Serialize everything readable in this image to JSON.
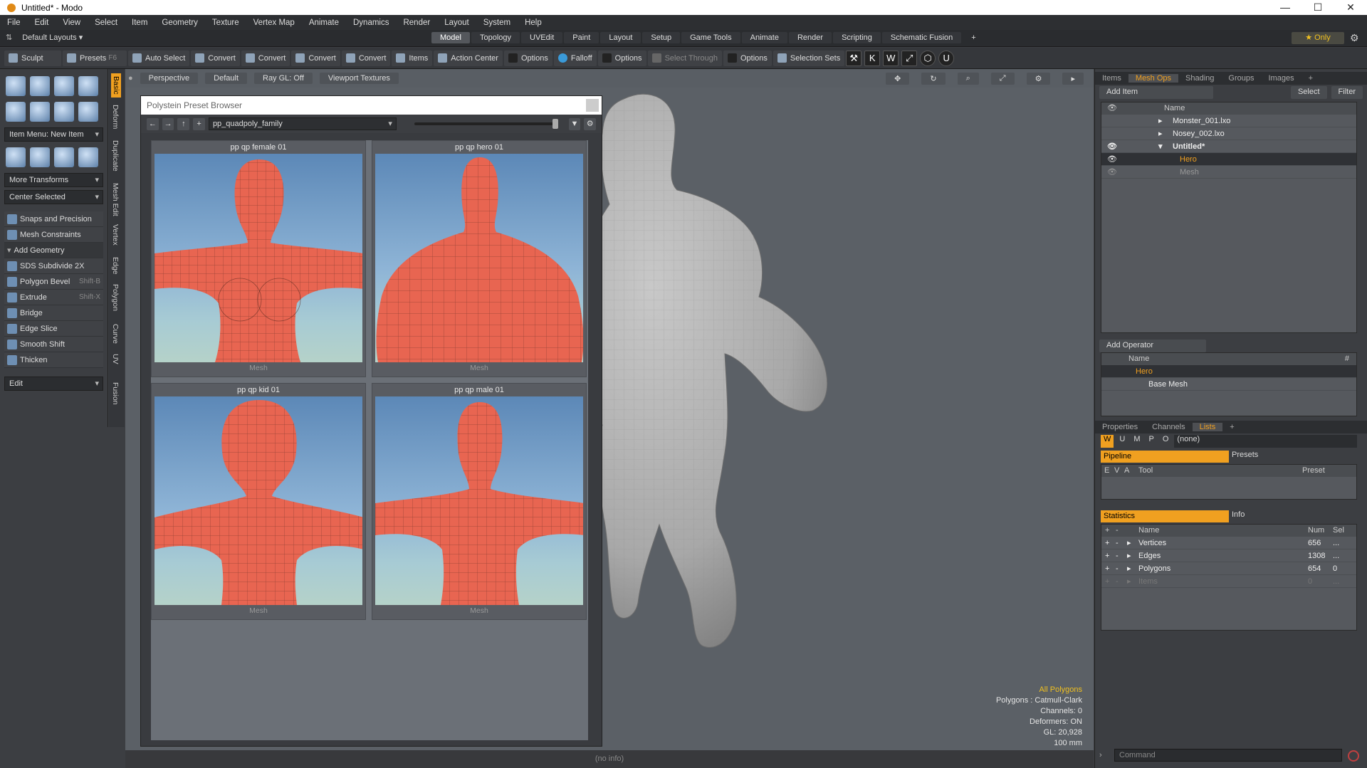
{
  "window": {
    "title": "Untitled* - Modo",
    "minimize": "—",
    "maximize": "☐",
    "close": "✕"
  },
  "menu": [
    "File",
    "Edit",
    "View",
    "Select",
    "Item",
    "Geometry",
    "Texture",
    "Vertex Map",
    "Animate",
    "Dynamics",
    "Render",
    "Layout",
    "System",
    "Help"
  ],
  "layoutbar": {
    "layouts": "Default Layouts ▾",
    "tabs": [
      "Model",
      "Topology",
      "UVEdit",
      "Paint",
      "Layout",
      "Setup",
      "Game Tools",
      "Animate",
      "Render",
      "Scripting",
      "Schematic Fusion"
    ],
    "active_tab": "Model",
    "add": "+",
    "only": "★ Only"
  },
  "toolbar": {
    "sculpt": "Sculpt",
    "presets": "Presets",
    "presets_key": "F6",
    "auto_select": "Auto Select",
    "convert1": "Convert",
    "convert2": "Convert",
    "convert3": "Convert",
    "convert4": "Convert",
    "items": "Items",
    "action_center": "Action Center",
    "options1": "Options",
    "falloff": "Falloff",
    "options2": "Options",
    "select_through": "Select Through",
    "options3": "Options",
    "selection_sets": "Selection Sets"
  },
  "leftpanel": {
    "item_menu": "Item Menu: New Item",
    "more_transforms": "More Transforms",
    "center_selected": "Center Selected",
    "snaps": "Snaps and Precision",
    "constraints": "Mesh Constraints",
    "add_geometry": "Add Geometry",
    "tools": [
      {
        "label": "SDS Subdivide 2X",
        "key": ""
      },
      {
        "label": "Polygon Bevel",
        "key": "Shift-B"
      },
      {
        "label": "Extrude",
        "key": "Shift-X"
      },
      {
        "label": "Bridge",
        "key": ""
      },
      {
        "label": "Edge Slice",
        "key": ""
      },
      {
        "label": "Smooth Shift",
        "key": ""
      },
      {
        "label": "Thicken",
        "key": ""
      }
    ],
    "edit": "Edit",
    "vtabs": [
      "Basic",
      "Deform",
      "Duplicate",
      "Mesh Edit",
      "Vertex",
      "Edge",
      "Polygon",
      "Curve",
      "UV",
      "Fusion"
    ]
  },
  "viewport": {
    "perspective": "Perspective",
    "default": "Default",
    "raygl": "Ray GL: Off",
    "textures": "Viewport Textures",
    "overlay": {
      "line1": "All Polygons",
      "line2": "Polygons : Catmull-Clark",
      "line3": "Channels: 0",
      "line4": "Deformers: ON",
      "line5": "GL: 20,928",
      "line6": "100 mm"
    }
  },
  "browser": {
    "title": "Polystein Preset Browser",
    "path": "pp_quadpoly_family",
    "presets": [
      {
        "name": "pp qp female 01",
        "type": "Mesh"
      },
      {
        "name": "pp qp hero 01",
        "type": "Mesh"
      },
      {
        "name": "pp qp kid 01",
        "type": "Mesh"
      },
      {
        "name": "pp qp male 01",
        "type": "Mesh"
      }
    ]
  },
  "status": "(no info)",
  "right": {
    "tabs": [
      "Items",
      "Mesh Ops",
      "Shading",
      "Groups",
      "Images",
      "+"
    ],
    "active_tab": "Mesh Ops",
    "add_item": "Add Item",
    "select": "Select",
    "filter": "Filter",
    "name_col": "Name",
    "tree": [
      "Monster_001.lxo",
      "Nosey_002.lxo",
      "Untitled*",
      "Hero",
      "Mesh"
    ],
    "add_operator": "Add Operator",
    "op_name_col": "Name",
    "op_hash": "#",
    "ops": [
      "Hero",
      "Base Mesh"
    ],
    "ptabs": [
      "Properties",
      "Channels",
      "Lists",
      "+"
    ],
    "active_ptab": "Lists",
    "wumpo": [
      "W",
      "U",
      "M",
      "P",
      "O"
    ],
    "none": "(none)",
    "pipeline": "Pipeline",
    "presets": "Presets",
    "evtool": {
      "e": "E",
      "v": "V",
      "a": "A",
      "tool": "Tool",
      "preset": "Preset"
    },
    "statistics": "Statistics",
    "info": "Info",
    "stat_cols": {
      "name": "Name",
      "num": "Num",
      "sel": "Sel"
    },
    "stats": [
      {
        "name": "Vertices",
        "num": "656",
        "sel": "..."
      },
      {
        "name": "Edges",
        "num": "1308",
        "sel": "..."
      },
      {
        "name": "Polygons",
        "num": "654",
        "sel": "0"
      },
      {
        "name": "Items",
        "num": "0",
        "sel": "..."
      }
    ],
    "command": "Command"
  }
}
